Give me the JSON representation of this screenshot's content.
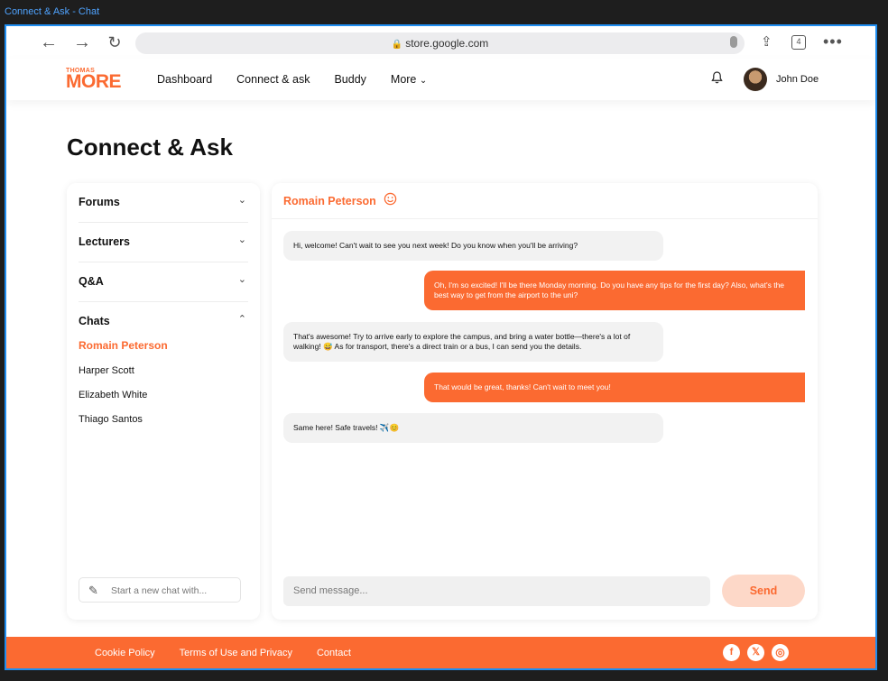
{
  "window": {
    "title": "Connect & Ask - Chat"
  },
  "browser": {
    "url": "store.google.com",
    "tab_count": "4"
  },
  "site": {
    "logo_top": "THOMAS",
    "logo_bottom": "MORE",
    "nav": [
      "Dashboard",
      "Connect & ask",
      "Buddy",
      "More"
    ],
    "user_name": "John Doe"
  },
  "page": {
    "title": "Connect & Ask"
  },
  "sidebar": {
    "sections": [
      "Forums",
      "Lecturers",
      "Q&A",
      "Chats"
    ],
    "chats": [
      "Romain Peterson",
      "Harper Scott",
      "Elizabeth White",
      "Thiago Santos"
    ],
    "new_chat_placeholder": "Start a new chat with..."
  },
  "chat": {
    "contact": "Romain Peterson",
    "messages": [
      {
        "dir": "in",
        "text": "Hi, welcome! Can't wait to see you next week! Do you know when you'll be arriving?"
      },
      {
        "dir": "out",
        "text": "Oh, I'm so excited! I'll be there Monday morning. Do you have any tips for the first day? Also, what's the best way to get from the airport to the uni?"
      },
      {
        "dir": "in",
        "text": "That's awesome! Try to arrive early to explore the campus, and bring a water bottle—there's a lot of walking! 😅 As for transport, there's a direct train or a bus, I can send you the details."
      },
      {
        "dir": "out",
        "text": "That would be great, thanks! Can't wait to meet you!"
      },
      {
        "dir": "in",
        "text": "Same here! Safe travels! ✈️😊"
      }
    ],
    "composer_placeholder": "Send message...",
    "send_label": "Send"
  },
  "footer": {
    "links": [
      "Cookie Policy",
      "Terms of Use and Privacy",
      "Contact"
    ],
    "social": [
      "facebook-icon",
      "x-icon",
      "instagram-icon"
    ]
  },
  "colors": {
    "accent": "#fb6a31",
    "send_bg": "#fdd8c8",
    "bubble_in": "#f2f2f2"
  }
}
